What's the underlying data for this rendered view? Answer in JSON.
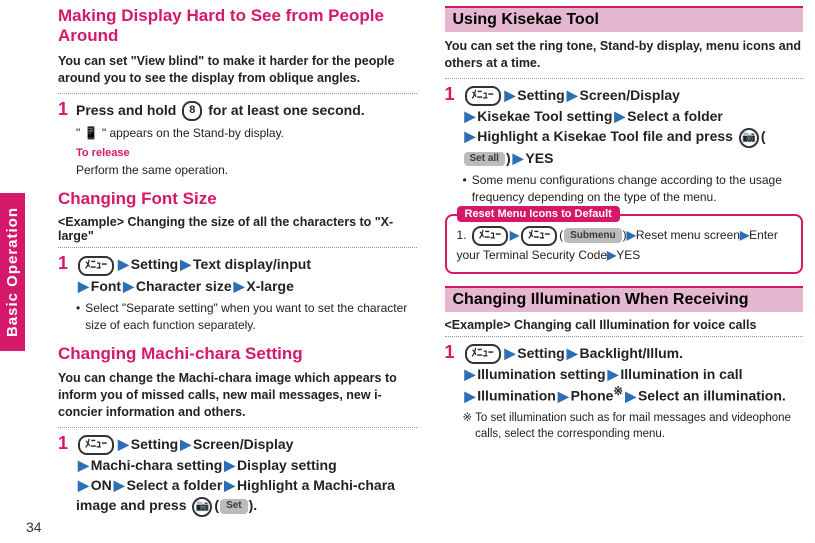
{
  "sideTab": "Basic Operation",
  "pageNumber": "34",
  "left": {
    "sec1": {
      "title": "Making Display Hard to See from People Around",
      "intro": "You can set \"View blind\" to make it harder for the people around you to see the display from oblique angles.",
      "step1_a": "Press and hold ",
      "step1_key": "8",
      "step1_b": " for at least one second.",
      "step1_sub": "\" 📱 \" appears on the Stand-by display.",
      "release_label": "To release",
      "release_text": "Perform the same operation."
    },
    "sec2": {
      "title": "Changing Font Size",
      "example": "<Example> Changing the size of all the characters to \"X-large\"",
      "key1": "ﾒﾆｭｰ",
      "p1": "Setting",
      "p2": "Text display/input",
      "p3": "Font",
      "p4": "Character size",
      "p5": "X-large",
      "bullet": "Select \"Separate setting\" when you want to set the character size of each function separately."
    },
    "sec3": {
      "title": "Changing Machi-chara Setting",
      "intro": "You can change the Machi-chara image which appears to inform you of missed calls, new mail messages, new i-concier information and others.",
      "key1": "ﾒﾆｭｰ",
      "p1": "Setting",
      "p2": "Screen/Display",
      "p3": "Machi-chara setting",
      "p4": "Display setting",
      "p5": "ON",
      "p6": "Select a folder",
      "p7a": "Highlight a Machi-chara image and press ",
      "camKey": "📷",
      "p7b": "(",
      "setLabel": "Set",
      "p7c": ")."
    }
  },
  "right": {
    "sec1": {
      "title": "Using Kisekae Tool",
      "intro": "You can set the ring tone, Stand-by display, menu icons and others at a time.",
      "key1": "ﾒﾆｭｰ",
      "p1": "Setting",
      "p2": "Screen/Display",
      "p3": "Kisekae Tool setting",
      "p4": "Select a folder",
      "p5a": "Highlight a Kisekae Tool file and press ",
      "camKey": "📷",
      "p5b": "(",
      "setAll": "Set all",
      "p5c": ")",
      "p6": "YES",
      "bullet": "Some menu configurations change according to the usage frequency depending on the type of the menu.",
      "resetTitle": "Reset Menu Icons to Default",
      "reset_key1": "ﾒﾆｭｰ",
      "reset_key2": "ﾒﾆｭｰ",
      "reset_sub": "Submenu",
      "reset_p1": "Reset menu screen",
      "reset_p2": "Enter your Terminal Security Code",
      "reset_p3": "YES"
    },
    "sec2": {
      "title": "Changing Illumination When Receiving",
      "example": "<Example> Changing call Illumination for voice calls",
      "key1": "ﾒﾆｭｰ",
      "p1": "Setting",
      "p2": "Backlight/Illum.",
      "p3": "Illumination setting",
      "p4": "Illumination in call",
      "p5": "Illumination",
      "p6": "Phone",
      "sup": "※",
      "p7": "Select an illumination.",
      "note": "To set illumination such as for mail messages and videophone calls, select the corresponding menu."
    }
  }
}
